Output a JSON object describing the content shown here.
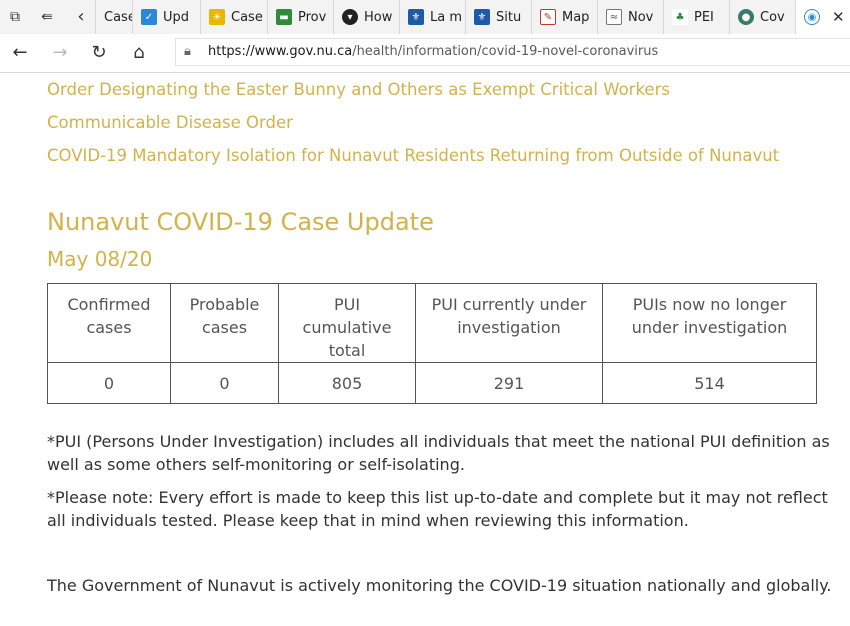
{
  "browser": {
    "tabs": [
      {
        "title": "Case",
        "favicon": "document-icon",
        "color": "#c9c9c9"
      },
      {
        "title": "Upd",
        "favicon": "alberta-icon",
        "color": "#2b88d8"
      },
      {
        "title": "Case",
        "favicon": "bc-icon",
        "color": "#e6b800"
      },
      {
        "title": "Prov",
        "favicon": "manitoba-icon",
        "color": "#2e8b3e"
      },
      {
        "title": "How",
        "favicon": "ontario-icon",
        "color": "#222222"
      },
      {
        "title": "La m",
        "favicon": "quebec-icon",
        "color": "#1f5aa6"
      },
      {
        "title": "Situ",
        "favicon": "quebec-icon",
        "color": "#1f5aa6"
      },
      {
        "title": "Map",
        "favicon": "nb-icon",
        "color": "#c0392b"
      },
      {
        "title": "Nov",
        "favicon": "ns-icon",
        "color": "#7f8c8d"
      },
      {
        "title": "PEI",
        "favicon": "pei-icon",
        "color": "#2e8b3e"
      },
      {
        "title": "Cov",
        "favicon": "globe-icon",
        "color": "#3a7a6a"
      }
    ],
    "url_host": "https://www.gov.nu.ca",
    "url_path": "/health/information/covid-19-novel-coronavirus"
  },
  "links": [
    "Order Designating the Easter Bunny and Others as Exempt Critical Workers",
    "Communicable Disease Order",
    "COVID-19 Mandatory Isolation for Nunavut Residents Returning from Outside of Nunavut"
  ],
  "update": {
    "title": "Nunavut COVID-19 Case Update",
    "date": "May 08/20"
  },
  "table": {
    "headers": [
      "Confirmed cases",
      "Probable cases",
      "PUI cumulative total",
      "PUI currently under investigation",
      "PUIs now no longer under investigation"
    ],
    "values": [
      "0",
      "0",
      "805",
      "291",
      "514"
    ]
  },
  "notes": {
    "pui_definition": "*PUI (Persons Under Investigation) includes all individuals that meet the national PUI definition as well as some others self-monitoring or self-isolating.",
    "please_note": "*Please note: Every effort is made to keep this list up-to-date and complete but it may not reflect all individuals tested. Please keep that in mind when reviewing this information.",
    "monitoring": "The Government of Nunavut is actively monitoring the COVID-19 situation nationally and globally."
  },
  "colors": {
    "accent": "#d4b24a",
    "text": "#333333"
  }
}
